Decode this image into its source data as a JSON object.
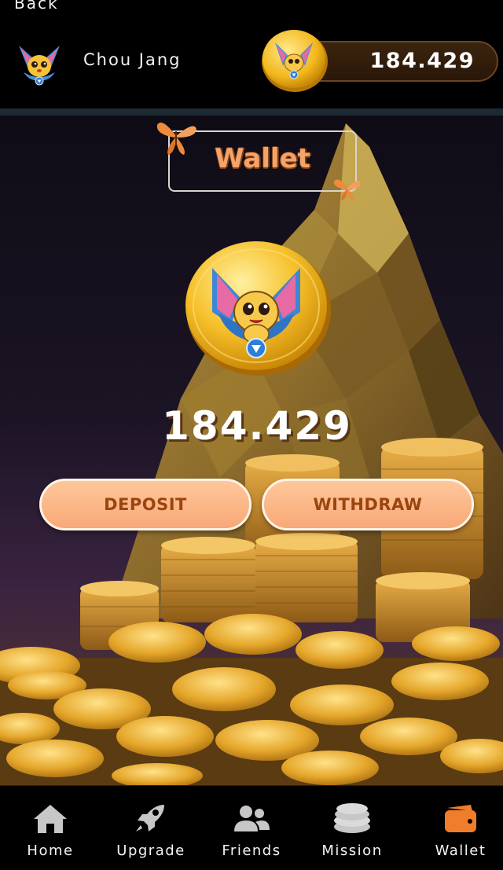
{
  "header": {
    "back_label": "Back",
    "user_name": "Chou Jang",
    "balance": "184.429"
  },
  "wallet": {
    "title": "Wallet",
    "balance": "184.429",
    "deposit_label": "DEPOSIT",
    "withdraw_label": "WITHDRAW"
  },
  "nav": {
    "items": [
      {
        "label": "Home",
        "icon": "home-icon"
      },
      {
        "label": "Upgrade",
        "icon": "rocket-icon"
      },
      {
        "label": "Friends",
        "icon": "friends-icon"
      },
      {
        "label": "Mission",
        "icon": "coins-stack-icon"
      },
      {
        "label": "Wallet",
        "icon": "wallet-icon"
      }
    ],
    "active": "Wallet"
  },
  "colors": {
    "accent": "#f8a877",
    "accent_text": "#9a4510",
    "active_nav": "#f07d2c",
    "nav_icon": "#c7c7c7",
    "pill_bg": "#3b240f"
  }
}
